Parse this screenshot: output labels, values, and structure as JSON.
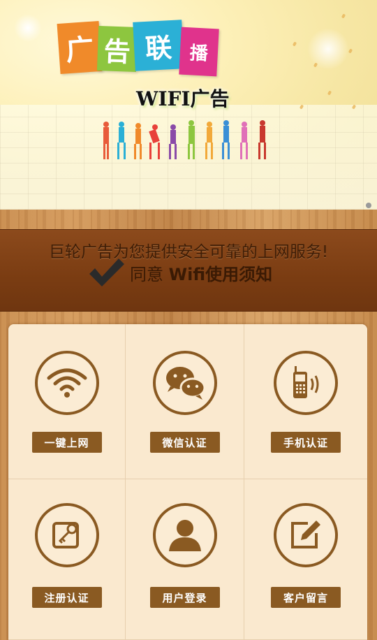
{
  "banner": {
    "logo_tiles": [
      "广",
      "告",
      "联",
      "播"
    ],
    "subtitle": "WIFI广告"
  },
  "agreement": {
    "message": "巨轮广告为您提供安全可靠的上网服务!",
    "prefix": "同意 ",
    "link": "Wifi使用须知"
  },
  "menu": [
    {
      "label": "一键上网",
      "icon": "wifi-icon"
    },
    {
      "label": "微信认证",
      "icon": "wechat-icon"
    },
    {
      "label": "手机认证",
      "icon": "mobile-phone-icon"
    },
    {
      "label": "注册认证",
      "icon": "key-register-icon"
    },
    {
      "label": "用户登录",
      "icon": "user-icon"
    },
    {
      "label": "客户留言",
      "icon": "edit-message-icon"
    }
  ],
  "colors": {
    "brown": "#8a5a22",
    "panel": "#7a3c12",
    "cream": "#fae9cf"
  }
}
